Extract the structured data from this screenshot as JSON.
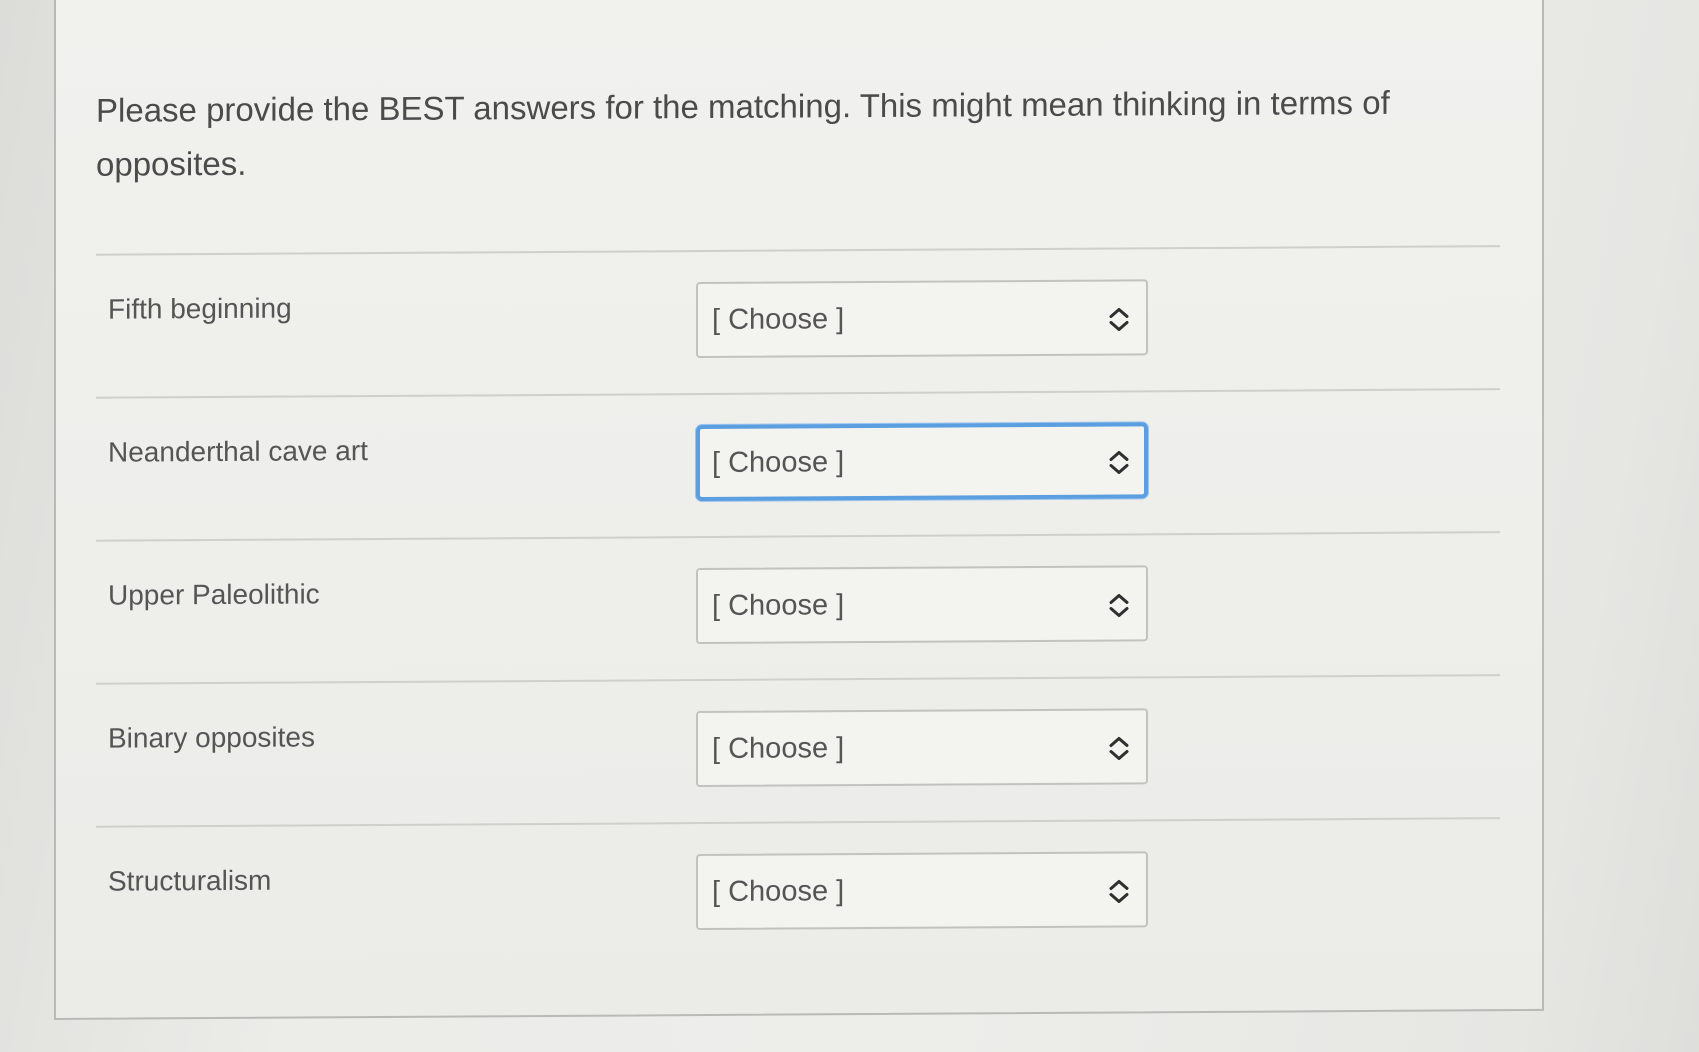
{
  "question": {
    "prompt": "Please provide the BEST answers for the matching. This might mean thinking in terms of opposites."
  },
  "matching": {
    "rows": [
      {
        "label": "Fifth beginning",
        "selected": "[ Choose ]",
        "focused": false
      },
      {
        "label": "Neanderthal cave art",
        "selected": "[ Choose ]",
        "focused": true
      },
      {
        "label": "Upper Paleolithic",
        "selected": "[ Choose ]",
        "focused": false
      },
      {
        "label": "Binary opposites",
        "selected": "[ Choose ]",
        "focused": false
      },
      {
        "label": "Structuralism",
        "selected": "[ Choose ]",
        "focused": false
      }
    ]
  },
  "icons": {
    "select_arrow": "chevron-up-down-icon"
  },
  "colors": {
    "focus_ring": "#5b9fe0",
    "text": "#555555",
    "card_background": "#f0f0ed"
  }
}
